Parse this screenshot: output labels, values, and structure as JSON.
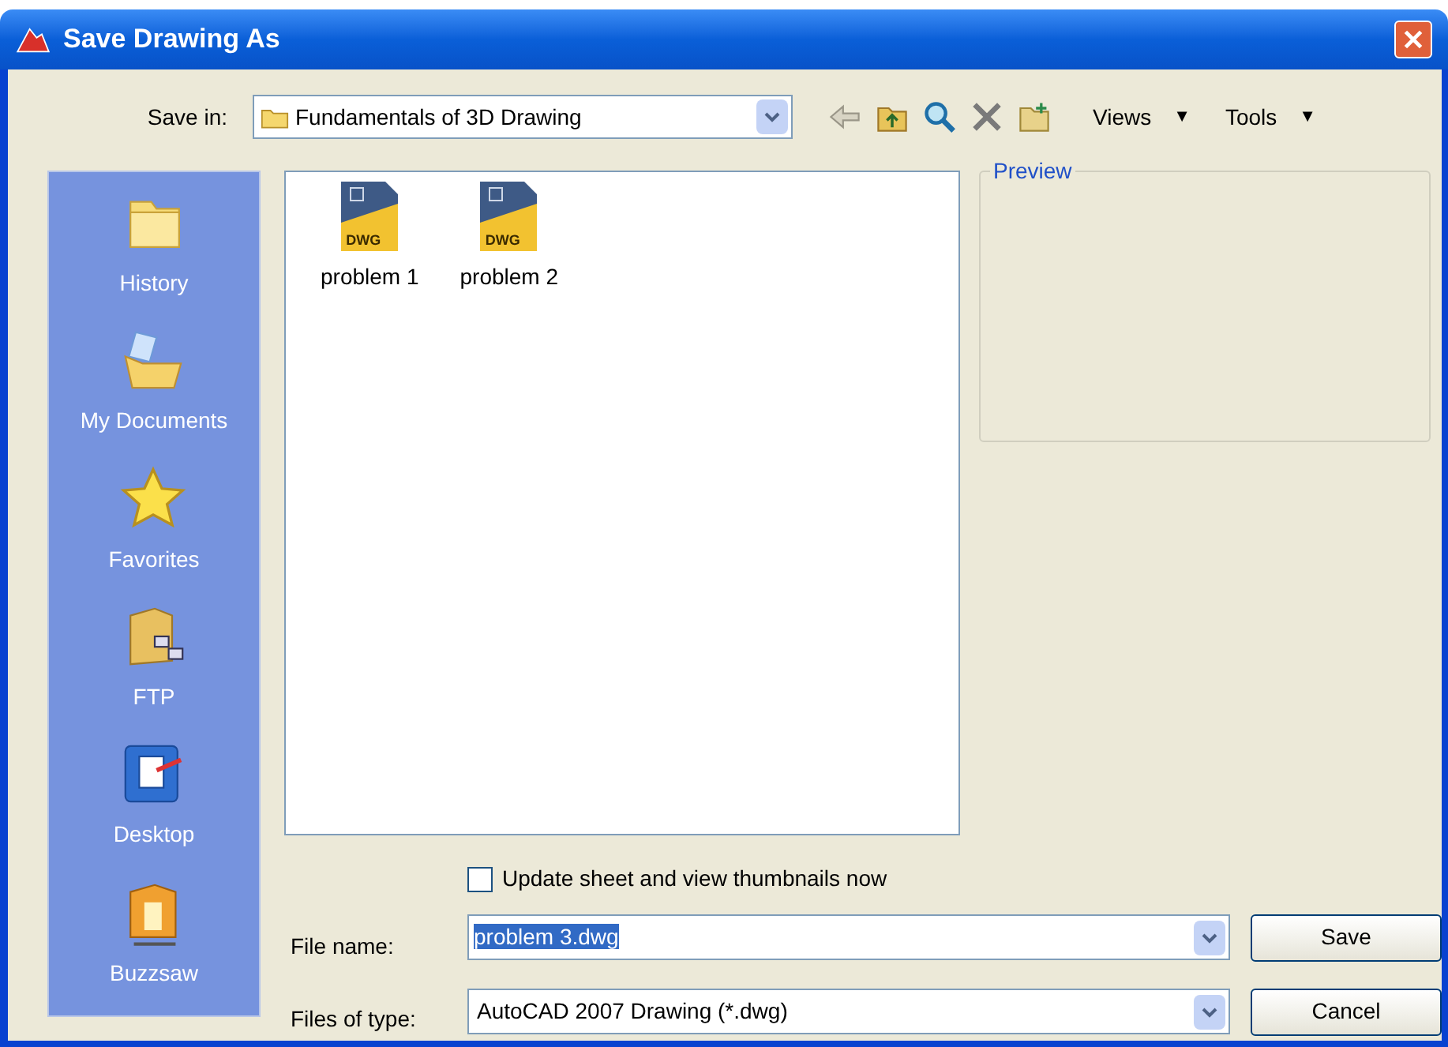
{
  "window": {
    "title": "Save Drawing As"
  },
  "save_in": {
    "label": "Save in:",
    "value": "Fundamentals of 3D Drawing"
  },
  "toolbar": {
    "menus": [
      {
        "label": "Views",
        "caret": "▼"
      },
      {
        "label": "Tools",
        "caret": "▼"
      }
    ]
  },
  "places": [
    {
      "kind": "history",
      "label": "History"
    },
    {
      "kind": "documents",
      "label": "My Documents"
    },
    {
      "kind": "favorites",
      "label": "Favorites"
    },
    {
      "kind": "ftp",
      "label": "FTP"
    },
    {
      "kind": "desktop",
      "label": "Desktop"
    },
    {
      "kind": "buzzsaw",
      "label": "Buzzsaw"
    }
  ],
  "files": [
    {
      "name": "problem 1",
      "badge": "DWG",
      "selected": false
    },
    {
      "name": "problem 2",
      "badge": "DWG",
      "selected": false
    }
  ],
  "preview": {
    "title": "Preview"
  },
  "update_thumbnails": {
    "label": "Update sheet and view thumbnails now",
    "checked": false
  },
  "file_name": {
    "label": "File name:",
    "value": "problem 3.dwg",
    "highlighted": true
  },
  "file_type": {
    "label": "Files of type:",
    "value": "AutoCAD 2007 Drawing (*.dwg)"
  },
  "buttons": [
    {
      "label": "Save"
    },
    {
      "label": "Cancel"
    }
  ]
}
